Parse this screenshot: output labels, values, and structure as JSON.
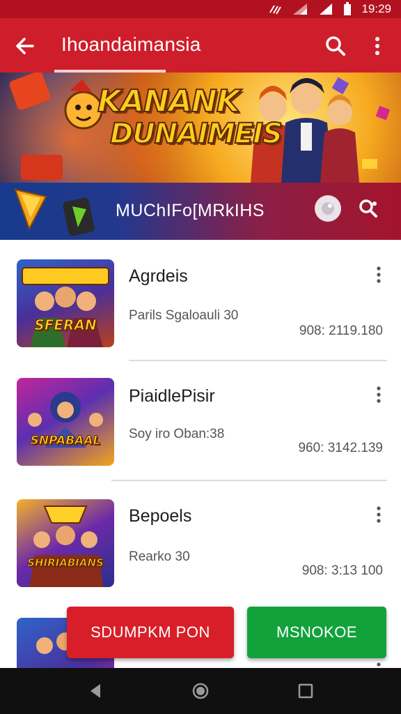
{
  "status_bar": {
    "time": "19:29"
  },
  "app_bar": {
    "title": "Ihoandaimansia"
  },
  "banner": {
    "line1": "KANANK",
    "line2": "DUNAIMEIS"
  },
  "promo_bar": {
    "label": "MUChIFo[MRkIHS"
  },
  "list": [
    {
      "name": "Agrdeis",
      "subtitle": "Parils Sgaloauli 30",
      "meta": "908: 2119.180",
      "art": "SFERAN"
    },
    {
      "name": "PiaidlePisir",
      "subtitle": "Soy iro Oban:38",
      "meta": "960: 3142.139",
      "art": "SNPABAAL"
    },
    {
      "name": "Bepoels",
      "subtitle": "Rearko 30",
      "meta": "908: 3:13 100",
      "art": "SHIRIABIANS"
    }
  ],
  "buttons": {
    "primary": "SDUMPKM PON",
    "secondary": "MSNOKOE"
  },
  "colors": {
    "primary": "#cf1e2b",
    "status": "#b2121f",
    "accent_green": "#12a23c",
    "accent_red": "#d81f29"
  }
}
